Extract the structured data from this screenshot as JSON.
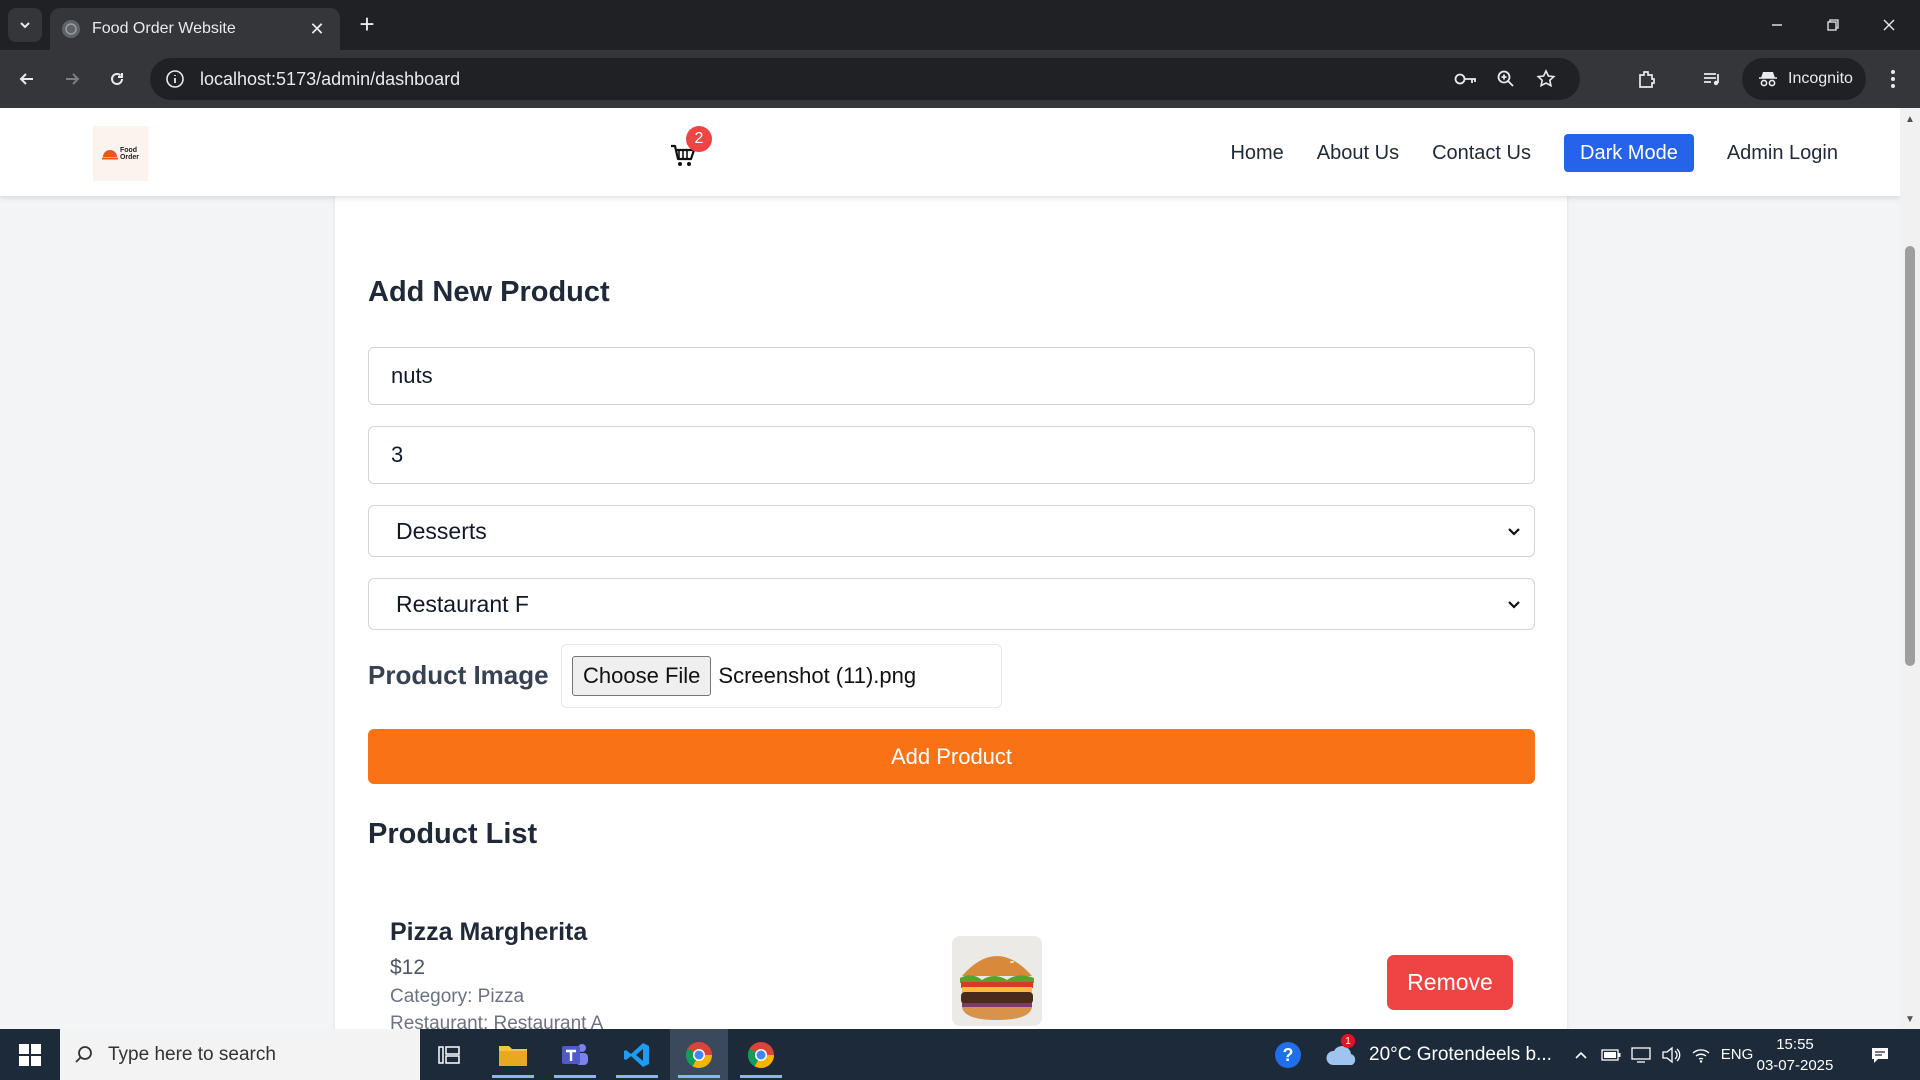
{
  "browser": {
    "tab_title": "Food Order Website",
    "url": "localhost:5173/admin/dashboard",
    "incognito_label": "Incognito"
  },
  "header": {
    "logo_text_line1": "Food",
    "logo_text_line2": "Order",
    "cart_count": "2",
    "nav": {
      "home": "Home",
      "about": "About Us",
      "contact": "Contact Us",
      "dark_mode": "Dark Mode",
      "admin_login": "Admin Login"
    }
  },
  "form": {
    "heading": "Add New Product",
    "name_value": "nuts",
    "price_value": "3",
    "category_selected": "Desserts",
    "restaurant_selected": "Restaurant F",
    "image_label": "Product Image",
    "choose_file_label": "Choose File",
    "file_name": "Screenshot (11).png",
    "submit_label": "Add Product"
  },
  "product_list": {
    "heading": "Product List",
    "items": [
      {
        "name": "Pizza Margherita",
        "price": "$12",
        "category": "Category: Pizza",
        "restaurant": "Restaurant: Restaurant A",
        "image": "burger-image",
        "remove_label": "Remove"
      }
    ]
  },
  "taskbar": {
    "search_placeholder": "Type here to search",
    "weather": "20°C  Grotendeels b...",
    "weather_badge": "1",
    "language": "ENG",
    "time": "15:55",
    "date": "03-07-2025"
  },
  "colors": {
    "accent_orange": "#f97316",
    "danger_red": "#ef4444",
    "primary_blue": "#2563eb"
  }
}
